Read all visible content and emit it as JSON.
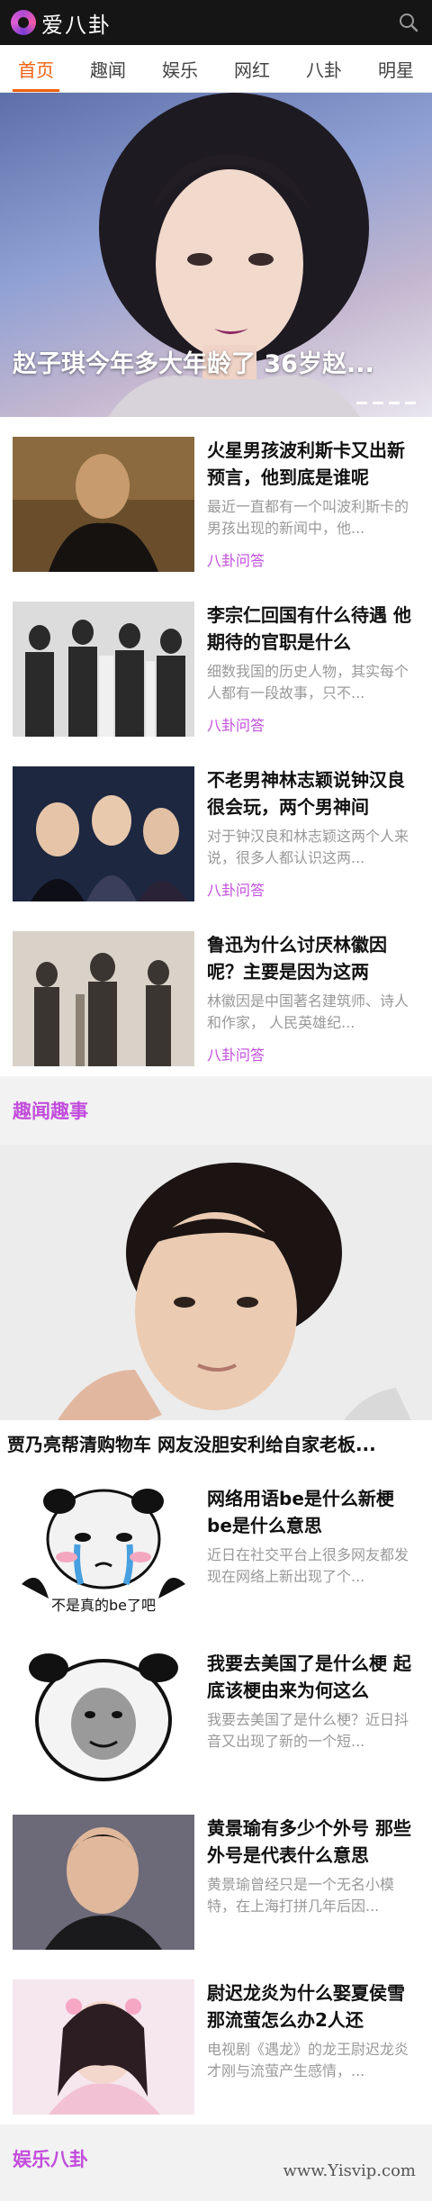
{
  "header": {
    "logo_text": "爱八卦",
    "icons": {
      "logo": "logo-icon",
      "search": "search-icon"
    }
  },
  "nav": {
    "tabs": [
      {
        "label": "首页",
        "active": true
      },
      {
        "label": "趣闻",
        "active": false
      },
      {
        "label": "娱乐",
        "active": false
      },
      {
        "label": "网红",
        "active": false
      },
      {
        "label": "八卦",
        "active": false
      },
      {
        "label": "明星",
        "active": false
      }
    ],
    "active_color": "#f06010"
  },
  "hero": {
    "title": "赵子琪今年多大年龄了 36岁赵..."
  },
  "articles": [
    {
      "title": "火星男孩波利斯卡又出新预言，他到底是谁呢",
      "desc": "最近一直都有一个叫波利斯卡的男孩出现的新闻中，他...",
      "tag": "八卦问答"
    },
    {
      "title": "李宗仁回国有什么待遇 他期待的官职是什么",
      "desc": "细数我国的历史人物，其实每个人都有一段故事，只不...",
      "tag": "八卦问答"
    },
    {
      "title": "不老男神林志颖说钟汉良很会玩，两个男神间",
      "desc": "对于钟汉良和林志颖这两个人来说，很多人都认识这两...",
      "tag": "八卦问答"
    },
    {
      "title": "鲁迅为什么讨厌林徽因呢？主要是因为这两",
      "desc": "林徽因是中国著名建筑师、诗人和作家， 人民英雄纪...",
      "tag": "八卦问答"
    }
  ],
  "section1": {
    "title": "趣闻趣事"
  },
  "feature": {
    "caption": "贾乃亮帮清购物车 网友没胆安利给自家老板..."
  },
  "articles2": [
    {
      "title": "网络用语be是什么新梗be是什么意思",
      "desc": "近日在社交平台上很多网友都发现在网络上新出现了个...",
      "thumb_text": "不是真的be了吧"
    },
    {
      "title": "我要去美国了是什么梗 起底该梗由来为何这么",
      "desc": "我要去美国了是什么梗？近日抖音又出现了新的一个短..."
    },
    {
      "title": "黄景瑜有多少个外号 那些外号是代表什么意思",
      "desc": "黄景瑜曾经只是一个无名小模特，在上海打拼几年后因..."
    },
    {
      "title": "尉迟龙炎为什么娶夏侯雪 那流萤怎么办2人还",
      "desc": "电视剧《遇龙》的龙王尉迟龙炎才刚与流萤产生感情，..."
    }
  ],
  "section2": {
    "title": "娱乐八卦"
  },
  "watermark": "www.Yisvip.com",
  "colors": {
    "accent": "#c24ddc",
    "topbar": "#151515"
  }
}
